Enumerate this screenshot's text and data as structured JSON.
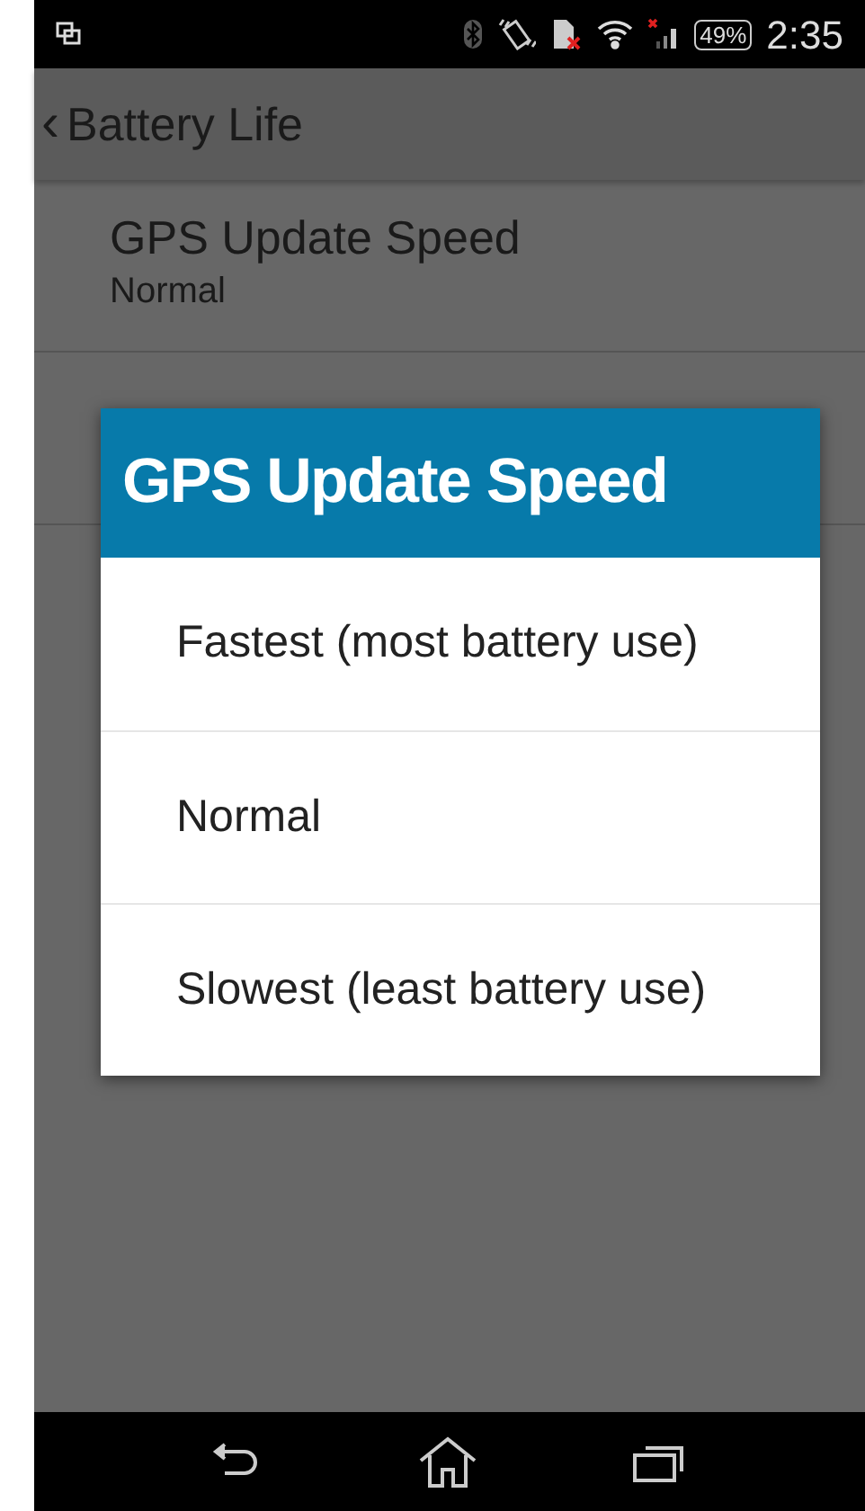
{
  "status_bar": {
    "battery": "49%",
    "time": "2:35"
  },
  "action_bar": {
    "back_glyph": "‹",
    "title": "Battery Life"
  },
  "settings": [
    {
      "title": "GPS Update Speed",
      "summary": "Normal"
    }
  ],
  "dialog": {
    "title": "GPS Update Speed",
    "options": [
      "Fastest (most battery use)",
      "Normal",
      "Slowest (least battery use)"
    ]
  }
}
